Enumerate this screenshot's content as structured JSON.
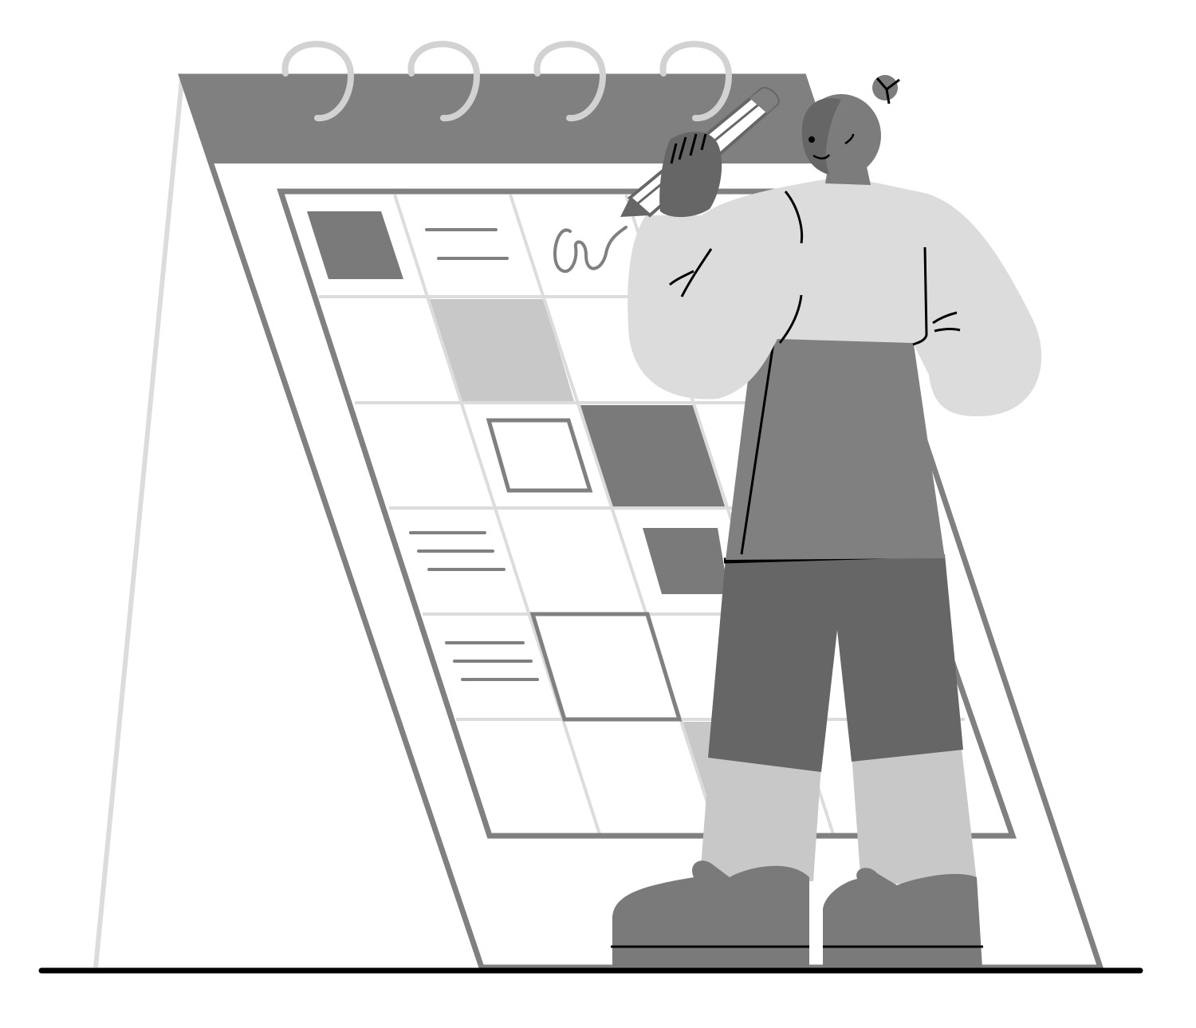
{
  "illustration": {
    "subject": "calendar-planning",
    "icon": "calendar-icon",
    "colors": {
      "background": "#ffffff",
      "header": "#808080",
      "dark": "#666666",
      "mid": "#7a7a7a",
      "light": "#c8c8c8",
      "lighter": "#dcdcdc",
      "outline": "#000000",
      "ring": "#d2d2d2",
      "skin": "#7c7c7c"
    }
  }
}
